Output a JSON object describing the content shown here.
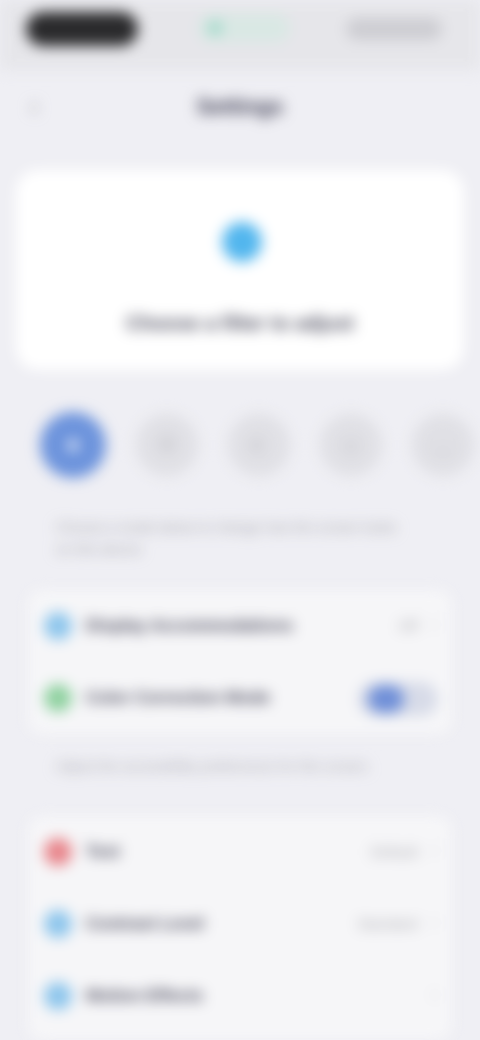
{
  "colors": {
    "background": "#efeff4",
    "accent": "#6c93dc",
    "hero_icon": "#52b6ee",
    "status_green": "#8ed19f",
    "status_red": "#e8848a",
    "info_blue": "#8cc5ec"
  },
  "nav": {
    "back_icon": "chevron-left-icon",
    "title": "Settings"
  },
  "hero": {
    "icon": "droplet-icon",
    "label": "Choose a filter to adjust"
  },
  "tabs": [
    {
      "icon": "filter-icon",
      "active": true
    },
    {
      "icon": "sliders-icon",
      "active": false
    },
    {
      "icon": "palette-icon",
      "active": false
    },
    {
      "icon": "brightness-icon",
      "active": false
    },
    {
      "icon": "more-icon",
      "active": false
    }
  ],
  "tabs_description": "Choose a mode below to change how the screen looks on this device",
  "group1": {
    "rows": [
      {
        "icon": "display-icon",
        "label": "Display Accommodations",
        "value": "Off"
      },
      {
        "icon": "eye-icon",
        "label": "Color Correction Mode",
        "toggle": true
      }
    ],
    "footnote": "Adjust the accessibility preferences for this screen."
  },
  "group2": {
    "rows": [
      {
        "icon": "text-size-icon",
        "label": "Text",
        "value": "Default"
      },
      {
        "icon": "contrast-icon",
        "label": "Contrast Level",
        "value": "Standard"
      },
      {
        "icon": "motion-icon",
        "label": "Motion Effects"
      }
    ]
  }
}
